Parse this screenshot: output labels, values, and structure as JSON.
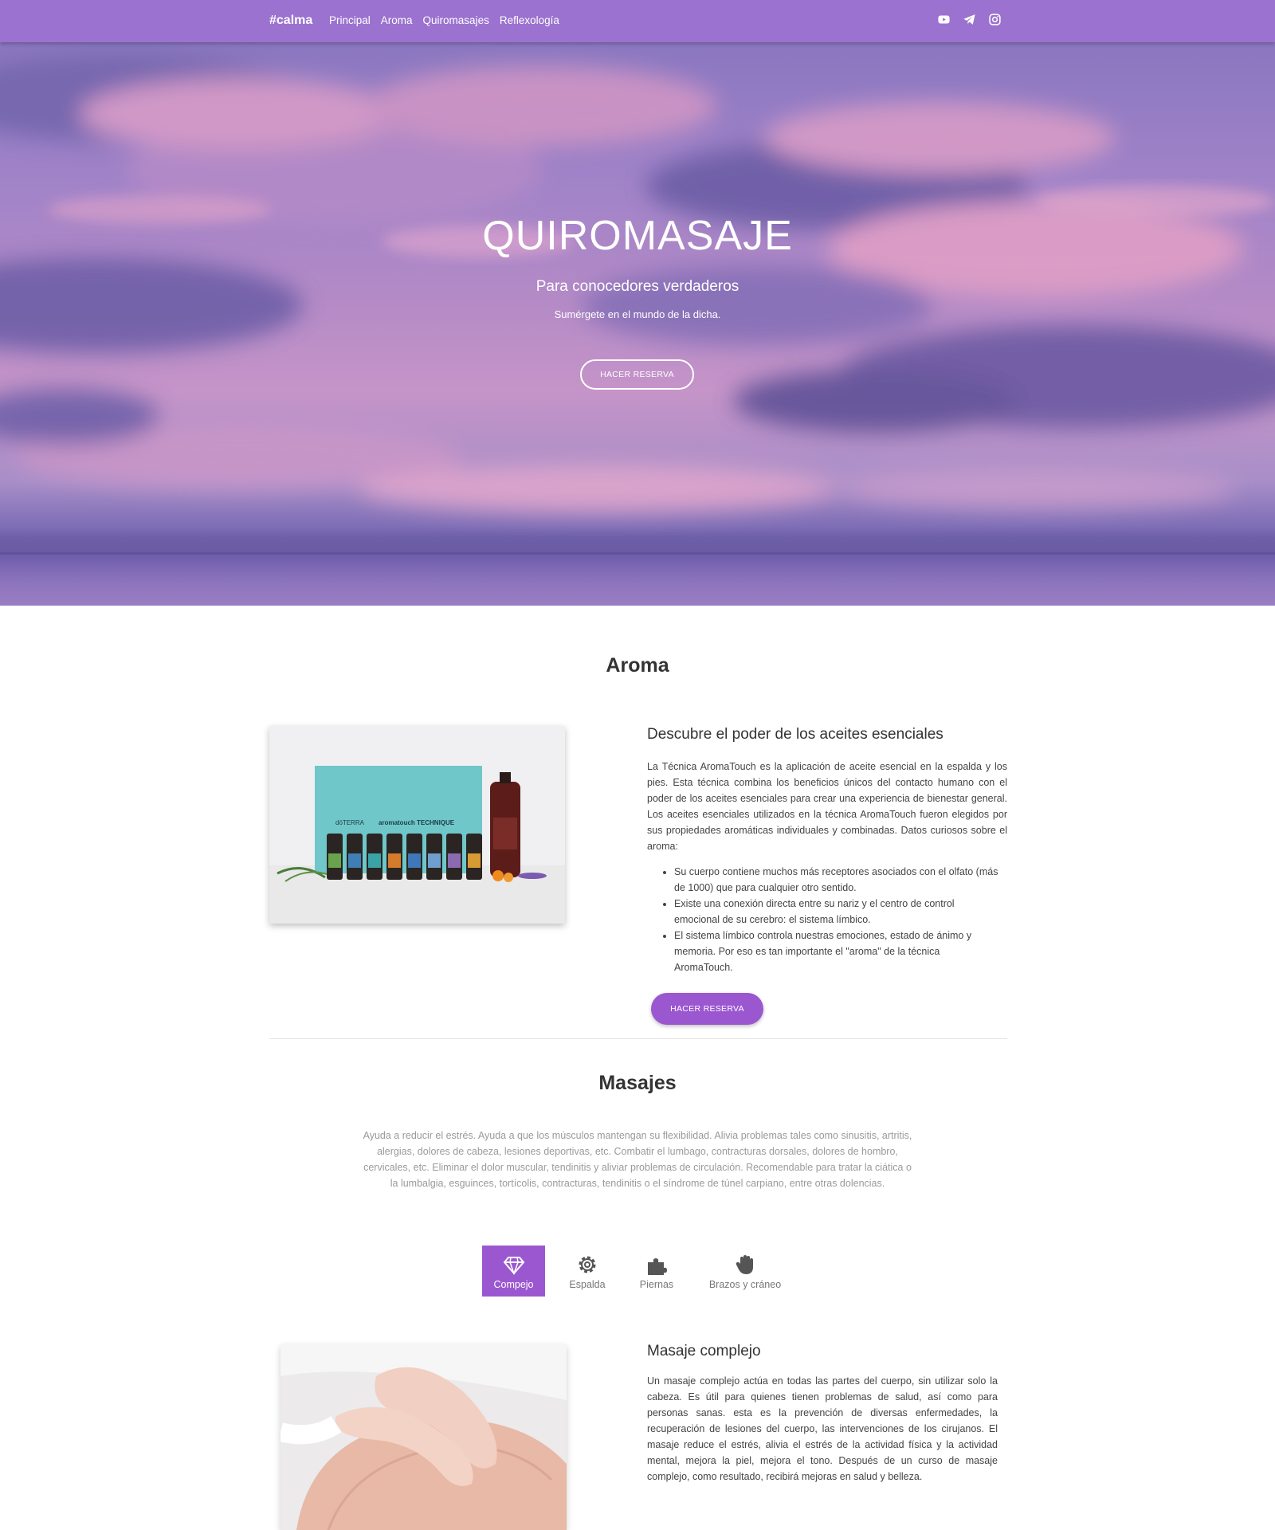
{
  "navbar": {
    "brand": "#calma",
    "links": [
      "Principal",
      "Aroma",
      "Quiromasajes",
      "Reflexología"
    ],
    "icons": [
      "youtube-icon",
      "telegram-icon",
      "instagram-icon"
    ]
  },
  "hero": {
    "title": "QUIROMASAJE",
    "subtitle": "Para conocedores verdaderos",
    "text": "Sumérgete en el mundo de la dicha.",
    "button": "HACER RESERVA"
  },
  "aroma": {
    "title": "Aroma",
    "heading": "Descubre el poder de los aceites esenciales",
    "paragraph": "La Técnica AromaTouch es la aplicación de aceite esencial en la espalda y los pies. Esta técnica combina los beneficios únicos del contacto humano con el poder de los aceites esenciales para crear una experiencia de bienestar general. Los aceites esenciales utilizados en la técnica AromaTouch fueron elegidos por sus propiedades aromáticas individuales y combinadas. Datos curiosos sobre el aroma:",
    "bullets": [
      "Su cuerpo contiene muchos más receptores asociados con el olfato (más de 1000) que para cualquier otro sentido.",
      "Existe una conexión directa entre su nariz y el centro de control emocional de su cerebro: el sistema límbico.",
      "El sistema límbico controla nuestras emociones, estado de ánimo y memoria. Por eso es tan importante el \"aroma\" de la técnica AromaTouch."
    ],
    "image_text_brand": "dōTERRA",
    "image_text_product": "aromatouch TECHNIQUE",
    "button": "HACER RESERVA"
  },
  "masajes": {
    "title": "Masajes",
    "description": "Ayuda a reducir el estrés. Ayuda a que los músculos mantengan su flexibilidad. Alivia problemas tales como sinusitis, artritis, alergias, dolores de cabeza, lesiones deportivas, etc. Combatir el lumbago, contracturas dorsales, dolores de hombro, cervicales, etc. Eliminar el dolor muscular, tendinitis y aliviar problemas de circulación. Recomendable para tratar la ciática o la lumbalgia, esguinces, tortícolis, contracturas, tendinitis o el síndrome de túnel carpiano, entre otras dolencias.",
    "tabs": [
      {
        "label": "Compejo",
        "icon": "diamond-icon",
        "active": true
      },
      {
        "label": "Espalda",
        "icon": "gear-icon",
        "active": false
      },
      {
        "label": "Piernas",
        "icon": "puzzle-icon",
        "active": false
      },
      {
        "label": "Brazos y cráneo",
        "icon": "hand-icon",
        "active": false
      }
    ],
    "card": {
      "heading": "Masaje complejo",
      "paragraph": "Un masaje complejo actúa en todas las partes del cuerpo, sin utilizar solo la cabeza. Es útil para quienes tienen problemas de salud, así como para personas sanas. esta es la prevención de diversas enfermedades, la recuperación de lesiones del cuerpo, las intervenciones de los cirujanos. El masaje reduce el estrés, alivia el estrés de la actividad física y la actividad mental, mejora la piel, mejora el tono. Después de un curso de masaje complejo, como resultado, recibirá mejoras en salud y belleza."
    }
  },
  "colors": {
    "navbar": "#9b72cf",
    "accent": "#9b57d0",
    "muted_text": "#9a9a9a"
  }
}
